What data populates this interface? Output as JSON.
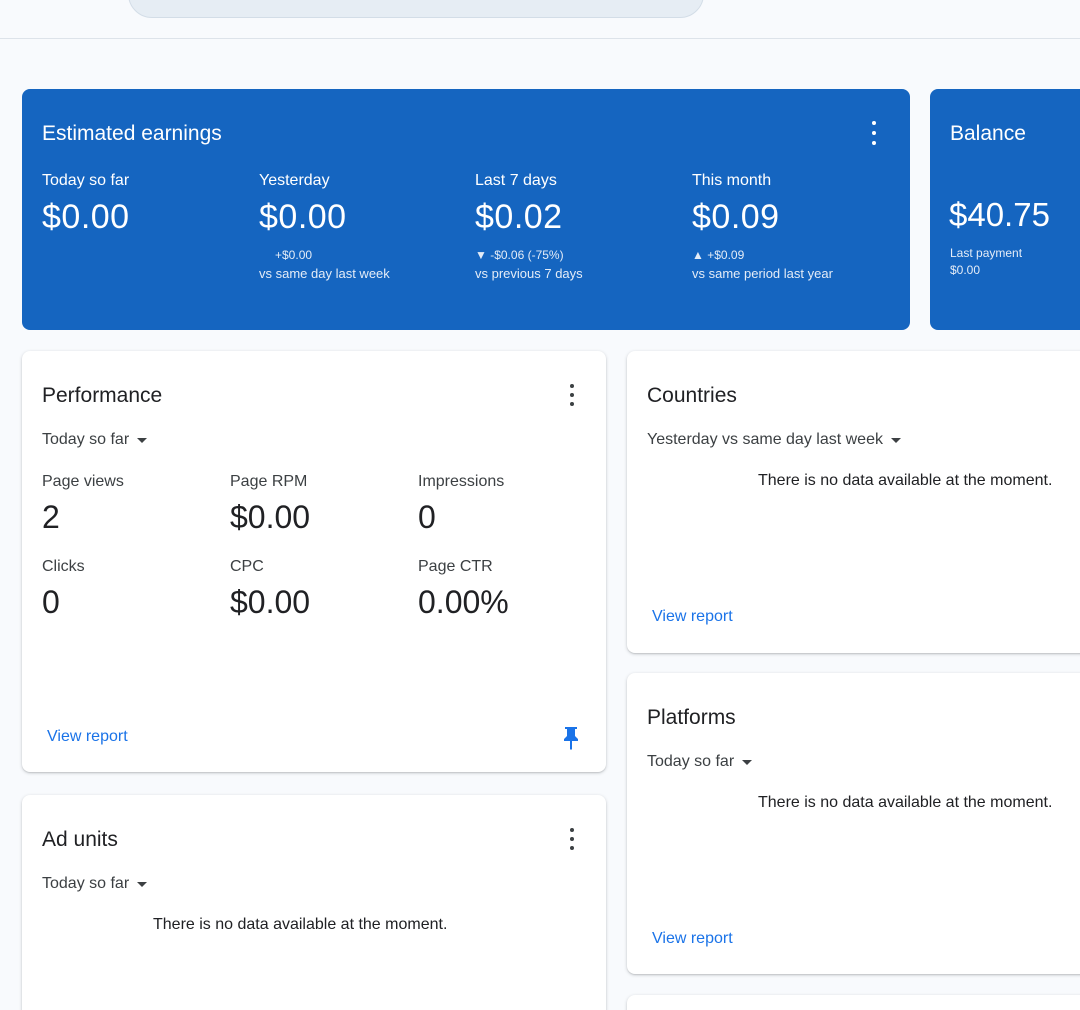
{
  "earnings": {
    "title": "Estimated earnings",
    "metrics": [
      {
        "label": "Today so far",
        "value": "$0.00",
        "change": "",
        "compare": ""
      },
      {
        "label": "Yesterday",
        "value": "$0.00",
        "change": "+$0.00",
        "compare": "vs same day last week"
      },
      {
        "label": "Last 7 days",
        "value": "$0.02",
        "change": "▼ -$0.06 (-75%)",
        "compare": "vs previous 7 days"
      },
      {
        "label": "This month",
        "value": "$0.09",
        "change": "▲ +$0.09",
        "compare": "vs same period last year"
      }
    ]
  },
  "balance": {
    "title": "Balance",
    "value": "$40.75",
    "last_payment_label": "Last payment",
    "last_payment_value": "$0.00"
  },
  "performance": {
    "title": "Performance",
    "period": "Today so far",
    "stats": [
      {
        "label": "Page views",
        "value": "2"
      },
      {
        "label": "Page RPM",
        "value": "$0.00"
      },
      {
        "label": "Impressions",
        "value": "0"
      },
      {
        "label": "Clicks",
        "value": "0"
      },
      {
        "label": "CPC",
        "value": "$0.00"
      },
      {
        "label": "Page CTR",
        "value": "0.00%"
      }
    ],
    "view_report": "View report"
  },
  "countries": {
    "title": "Countries",
    "period": "Yesterday vs same day last week",
    "no_data": "There is no data available at the moment.",
    "view_report": "View report"
  },
  "platforms": {
    "title": "Platforms",
    "period": "Today so far",
    "no_data": "There is no data available at the moment.",
    "view_report": "View report"
  },
  "ad_units": {
    "title": "Ad units",
    "period": "Today so far",
    "no_data": "There is no data available at the moment."
  },
  "colors": {
    "accent": "#1565c0",
    "link": "#1a73e8"
  }
}
